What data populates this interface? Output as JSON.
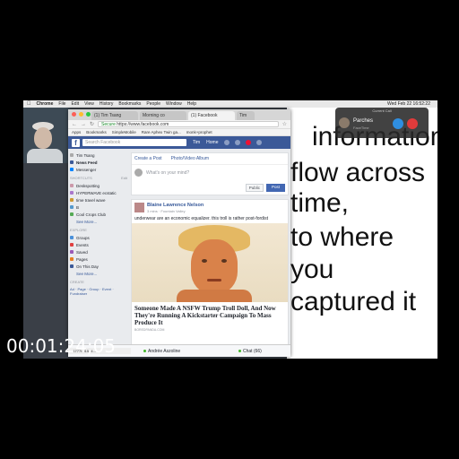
{
  "menubar": {
    "app": "Chrome",
    "items": [
      "File",
      "Edit",
      "View",
      "History",
      "Bookmarks",
      "People",
      "Window",
      "Help"
    ],
    "clock": "Wed Feb 22  16:52:22"
  },
  "chrome": {
    "tabs": [
      "(1) Tim Tsang",
      "Morning co",
      "(1) Facebook"
    ],
    "tab_extra": "Tim",
    "url_secure": "Secure",
    "url": "https://www.facebook.com",
    "bookmarks": [
      "Apps",
      "Bookmarks",
      "SimpleMobile",
      "Rare Aphex Twin ga...",
      "monk+prophet"
    ],
    "status_url": "...1777601544..."
  },
  "facebook": {
    "search_placeholder": "Search Facebook",
    "profile_name": "Tim",
    "home_label": "Home",
    "leftnav": {
      "user": "Tim Tsang",
      "news_feed": "News Feed",
      "messenger": "Messenger",
      "shortcuts_label": "SHORTCUTS",
      "shortcuts_edit": "Edit",
      "shortcuts": [
        "Deskspotting",
        "HYPERWAVE ecstatic",
        "time travel wave",
        "B",
        "Cool Crops Club"
      ],
      "see_more": "See More...",
      "explore_label": "EXPLORE",
      "explore": [
        "Groups",
        "Events",
        "Saved",
        "Pages",
        "On This Day"
      ],
      "see_more_2": "See More...",
      "create_label": "CREATE",
      "create_items": "Ad · Page · Group · Event · Fundraiser"
    },
    "composer": {
      "create_post": "Create a Post",
      "photo_video": "Photo/Video Album",
      "placeholder": "What's on your mind?",
      "public": "Public",
      "post": "Post"
    },
    "post": {
      "author": "Blaine Lawrence Nelson",
      "meta": "3 mins · Fountain Valley",
      "text": "underwear are an economic equalizer. this troll is rather post-fordist",
      "headline": "Someone Made A NSFW Trump Troll Doll, And Now They're Running A Kickstarter Campaign To Mass Produce It",
      "source": "BOREDPANDA.COM"
    },
    "chat_left": "Andrée Aszoline",
    "chat_right": "Chat (66)"
  },
  "notification": {
    "title": "Current Call",
    "name": "Parches",
    "subtitle": "FaceTime"
  },
  "slide": {
    "lines": [
      "information",
      "flow across",
      "time,",
      "to where",
      "you",
      "captured it"
    ]
  },
  "timecode": "00:01:24;05",
  "colors": {
    "facebook_blue": "#3b5998",
    "decline": "#e03b3b",
    "accept": "#2f8ee0"
  }
}
